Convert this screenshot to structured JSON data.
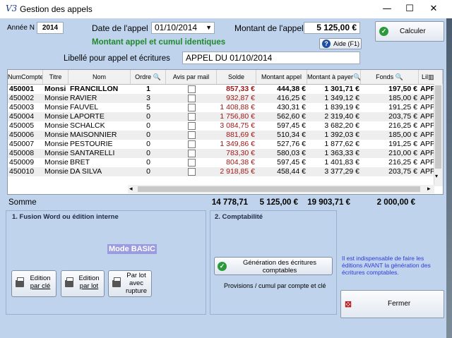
{
  "window": {
    "title": "Gestion des appels",
    "app_icon": "V3"
  },
  "controls": {
    "minimize": "—",
    "maximize": "☐",
    "close": "✕"
  },
  "form": {
    "annee_label": "Année N",
    "annee_value": "2014",
    "date_label": "Date de l'appel :",
    "date_value": "01/10/2014",
    "montant_label": "Montant de l'appel",
    "montant_value": "5 125,00 €",
    "status_message": "Montant appel et cumul identiques",
    "libelle_label": "Libellé pour appel et écritures",
    "libelle_value": "APPEL DU 01/10/2014"
  },
  "buttons": {
    "calculer": "Calculer",
    "aide": "Aide (F1)",
    "fermer": "Fermer"
  },
  "table": {
    "headers": [
      "NumCompte",
      "Titre",
      "Nom",
      "Ordre",
      "Avis par mail",
      "Solde",
      "Montant appel",
      "Montant à payer",
      "Fonds",
      "Lil"
    ],
    "rows": [
      [
        "450001",
        "Monsi",
        "FRANCILLON",
        "1",
        "857,33 €",
        "444,38 €",
        "1 301,71 €",
        "197,50 €",
        "APP"
      ],
      [
        "450002",
        "Monsie",
        "RAVIER",
        "3",
        "932,87 €",
        "416,25 €",
        "1 349,12 €",
        "185,00 €",
        "APP"
      ],
      [
        "450003",
        "Monsie",
        "FAUVEL",
        "5",
        "1 408,88 €",
        "430,31 €",
        "1 839,19 €",
        "191,25 €",
        "APP"
      ],
      [
        "450004",
        "Monsie",
        "LAPORTE",
        "0",
        "1 756,80 €",
        "562,60 €",
        "2 319,40 €",
        "203,75 €",
        "APP"
      ],
      [
        "450005",
        "Monsie",
        "SCHALCK",
        "0",
        "3 084,75 €",
        "597,45 €",
        "3 682,20 €",
        "216,25 €",
        "APP"
      ],
      [
        "450006",
        "Monsie",
        "MAISONNIER",
        "0",
        "881,69 €",
        "510,34 €",
        "1 392,03 €",
        "185,00 €",
        "APP"
      ],
      [
        "450007",
        "Monsie",
        "PESTOURIE",
        "0",
        "1 349,86 €",
        "527,76 €",
        "1 877,62 €",
        "191,25 €",
        "APP"
      ],
      [
        "450008",
        "Monsie",
        "SANTARELLI",
        "0",
        "783,30 €",
        "580,03 €",
        "1 363,33 €",
        "210,00 €",
        "APP"
      ],
      [
        "450009",
        "Monsie",
        "BRET",
        "0",
        "804,38 €",
        "597,45 €",
        "1 401,83 €",
        "216,25 €",
        "APP"
      ],
      [
        "450010",
        "Monsie",
        "DA SILVA",
        "0",
        "2 918,85 €",
        "458,44 €",
        "3 377,29 €",
        "203,75 €",
        "APP"
      ]
    ],
    "totals_label": "Somme",
    "totals": {
      "solde": "14 778,71",
      "appel": "5 125,00 €",
      "payer": "19 903,71 €",
      "fonds": "2 000,00 €"
    }
  },
  "section1": {
    "title": "1. Fusion Word ou édition interne",
    "mode": "Mode BASIC",
    "btn1_line1": "Edition",
    "btn1_line2": "par clé",
    "btn2_line1": "Edition",
    "btn2_line2": "par lot",
    "btn3_line1": "Par lot",
    "btn3_line2": "avec",
    "btn3_line3": "rupture"
  },
  "section2": {
    "title": "2. Comptabilité",
    "gen_line1": "Génération des écritures",
    "gen_line2": "comptables",
    "note": "Provisions / cumul par compte et clé"
  },
  "info_text": "Il est indispensable de faire les éditions AVANT la génération des écritures comptables.",
  "colors": {
    "background": "#bfd3ec",
    "green": "#1f8a2a",
    "red": "#a01818",
    "mode_badge": "#9b9be0",
    "info_blue": "#2e3bdc"
  }
}
